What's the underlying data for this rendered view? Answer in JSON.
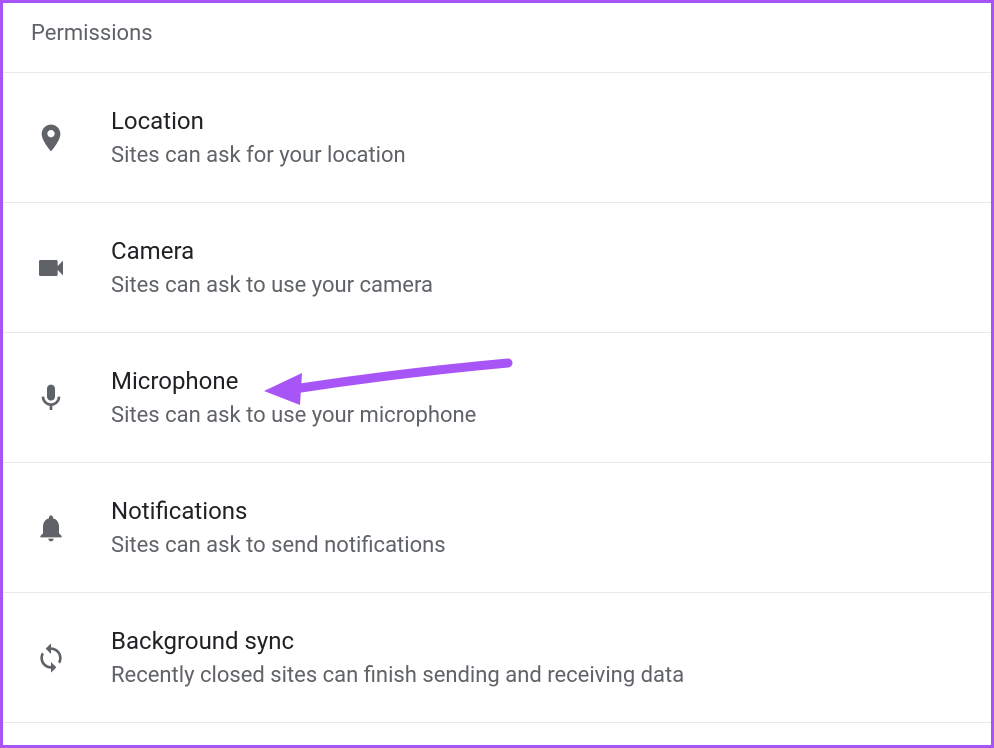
{
  "section_title": "Permissions",
  "permissions": [
    {
      "icon": "location-icon",
      "title": "Location",
      "desc": "Sites can ask for your location"
    },
    {
      "icon": "camera-icon",
      "title": "Camera",
      "desc": "Sites can ask to use your camera"
    },
    {
      "icon": "microphone-icon",
      "title": "Microphone",
      "desc": "Sites can ask to use your microphone"
    },
    {
      "icon": "notifications-icon",
      "title": "Notifications",
      "desc": "Sites can ask to send notifications"
    },
    {
      "icon": "sync-icon",
      "title": "Background sync",
      "desc": "Recently closed sites can finish sending and receiving data"
    }
  ],
  "annotation": {
    "color": "#a855f7"
  }
}
